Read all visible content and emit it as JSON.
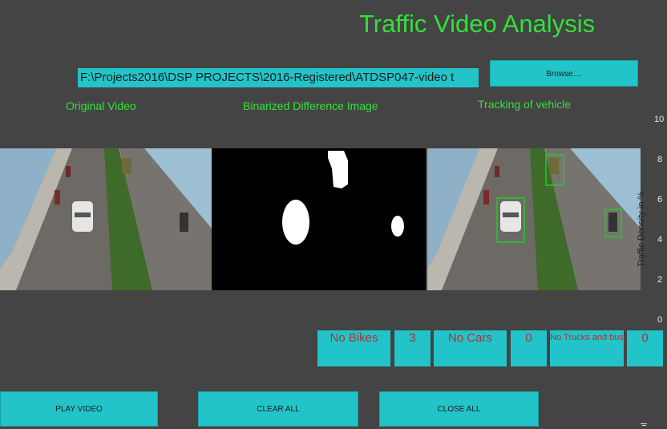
{
  "window": {
    "title": "Traffic Video Analysis",
    "file_path": "F:\\Projects2016\\DSP PROJECTS\\2016-Registered\\ATDSP047-video t",
    "browse_label": "Browse...."
  },
  "panels": {
    "original": "Original Video",
    "binarized": "Binarized Difference Image",
    "tracking": "Tracking of vehicle"
  },
  "density_axis": {
    "label": "Traffic Density in %",
    "ticks": [
      "10",
      "8",
      "6",
      "4",
      "2",
      "0"
    ]
  },
  "counts": {
    "bikes_label": "No Bikes",
    "bikes_value": "3",
    "cars_label": "No Cars",
    "cars_value": "0",
    "trucks_label": "No Trucks and bus",
    "trucks_value": "0"
  },
  "buttons": {
    "play": "PLAY VIDEO",
    "clear": "CLEAR ALL",
    "close": "CLOSE ALL"
  },
  "colors": {
    "background": "#444444",
    "accent_green": "#33e03a",
    "button_cyan": "#22c4c9",
    "count_text": "#b23030"
  }
}
